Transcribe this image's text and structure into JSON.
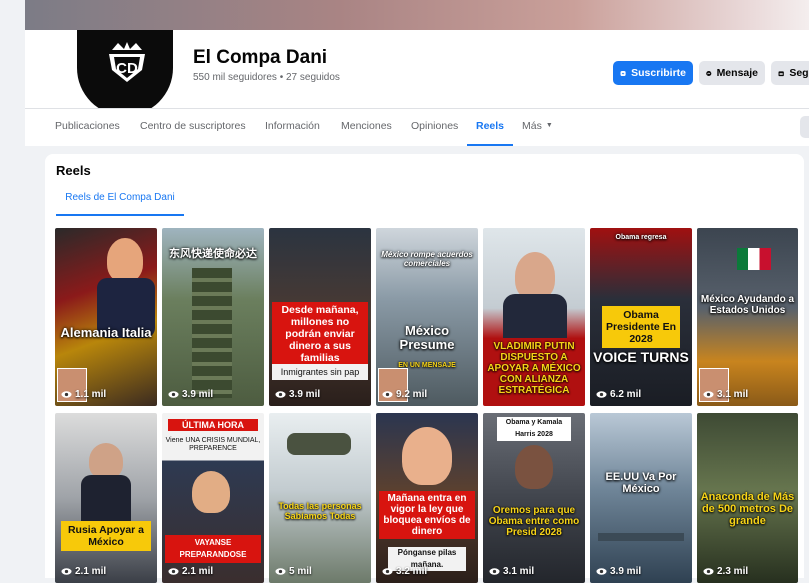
{
  "profile": {
    "name": "El Compa Dani",
    "stats": "550 mil seguidores • 27 seguidos",
    "avatar_text": "CD"
  },
  "actions": {
    "subscribe": "Suscribirte",
    "message": "Mensaje",
    "follow": "Seguir"
  },
  "tabs": [
    {
      "label": "Publicaciones"
    },
    {
      "label": "Centro de suscriptores"
    },
    {
      "label": "Información"
    },
    {
      "label": "Menciones"
    },
    {
      "label": "Opiniones"
    },
    {
      "label": "Reels"
    },
    {
      "label": "Más"
    }
  ],
  "more_button": "···",
  "reels": {
    "title": "Reels",
    "subtab": "Reels de El Compa Dani",
    "items": [
      {
        "caption": "Alemania Italia",
        "views": "1.1 mil"
      },
      {
        "caption": "东风快递使命必达",
        "views": "3.9 mil"
      },
      {
        "caption": "Desde mañana, millones no podrán enviar dinero a sus familias",
        "subcaption": "Inmigrantes sin pap",
        "views": "3.9 mil"
      },
      {
        "caption": "México Presume",
        "header": "México rompe acuerdos comerciales",
        "subcaption": "EN UN MENSAJE",
        "views": "9.2 mil"
      },
      {
        "caption": "VLADIMIR PUTIN DISPUESTO A APOYAR A MÉXICO CON ALIANZA ESTRATÉGICA",
        "views": ""
      },
      {
        "caption": "Obama Presidente En 2028",
        "header": "Obama regresa",
        "subcaption": "VOICE TURNS",
        "views": "6.2 mil"
      },
      {
        "caption": "México Ayudando a Estados Unidos",
        "views": "3.1 mil"
      },
      {
        "caption": "Rusia Apoyar a México",
        "views": "2.1 mil"
      },
      {
        "caption": "ÚLTIMA HORA",
        "header": "Viene UNA CRISIS MUNDIAL, PREPARENCE",
        "subcaption": "VAYANSE PREPARANDOSE",
        "views": "2.1 mil"
      },
      {
        "caption": "Todas las personas Sabíamos Todas",
        "views": "5 mil"
      },
      {
        "caption": "Mañana entra en vigor la ley que bloquea envíos de dinero",
        "subcaption": "Pónganse pilas mañana.",
        "views": "3.2 mil"
      },
      {
        "caption": "Oremos para que Obama entre como Presid 2028",
        "header": "Obama y Kamala Harris 2028",
        "views": "3.1 mil"
      },
      {
        "caption": "EE.UU Va Por México",
        "views": "3.9 mil"
      },
      {
        "caption": "Anaconda de Más de 500 metros De grande",
        "views": "2.3 mil"
      }
    ]
  },
  "colors": {
    "accent": "#1877f2",
    "secondary_button": "#e4e6eb",
    "page_bg": "#f0f2f5"
  },
  "icons": [
    "subscribe-icon",
    "messenger-icon",
    "follow-icon",
    "chevron-down-icon",
    "eye-icon"
  ]
}
